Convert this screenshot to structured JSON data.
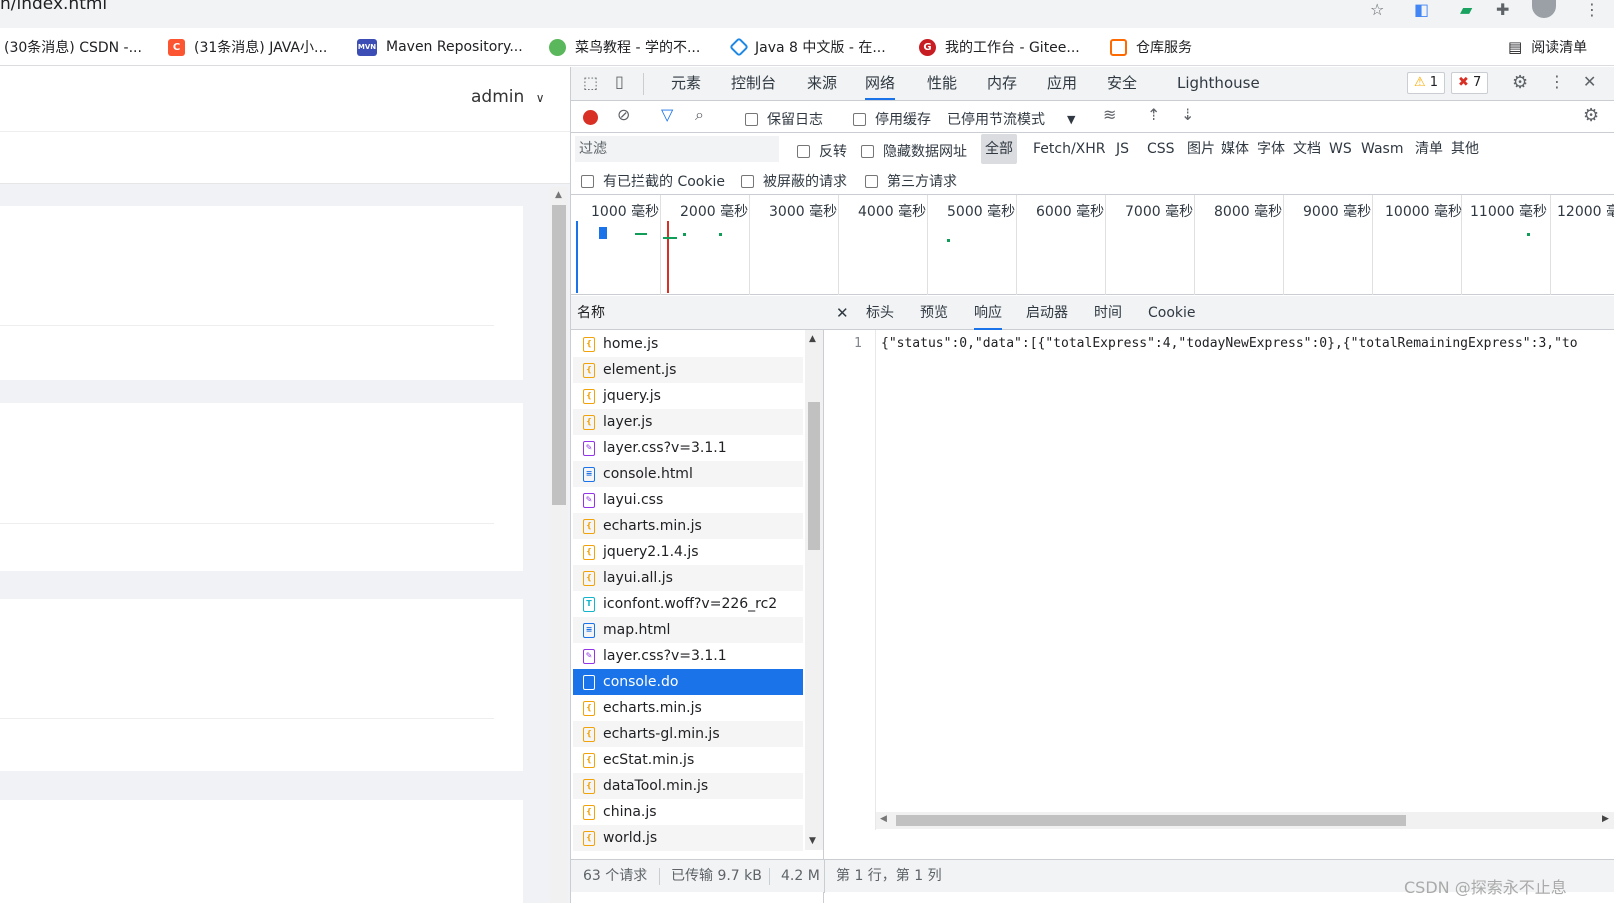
{
  "address": {
    "url": "n/index.html"
  },
  "bookmarks": [
    {
      "label": "(30条消息) CSDN -...",
      "color": "#ffffff",
      "glyph": ""
    },
    {
      "label": "(31条消息) JAVA小...",
      "color": "#fc5531",
      "glyph": "C"
    },
    {
      "label": "Maven Repository...",
      "color": "#3c4db5",
      "glyph": "MVN"
    },
    {
      "label": "菜鸟教程 - 学的不...",
      "color": "#5bb75b",
      "glyph": ""
    },
    {
      "label": "Java 8 中文版 - 在...",
      "color": "#1e88e5",
      "glyph": ""
    },
    {
      "label": "我的工作台 - Gitee...",
      "color": "#c71d23",
      "glyph": "G"
    },
    {
      "label": "仓库服务",
      "color": "#ff6a00",
      "glyph": ""
    }
  ],
  "reading_list": "阅读清单",
  "page": {
    "user": "admin"
  },
  "devtools": {
    "tabs": [
      "元素",
      "控制台",
      "来源",
      "网络",
      "性能",
      "内存",
      "应用",
      "安全",
      "Lighthouse"
    ],
    "active_tab": "网络",
    "warnings": "1",
    "errors": "7",
    "toolbar": {
      "preserve_log": "保留日志",
      "disable_cache": "停用缓存",
      "throttling": "已停用节流模式"
    },
    "filter": {
      "placeholder": "过滤",
      "invert": "反转",
      "hide_data_urls": "隐藏数据网址",
      "types": [
        "全部",
        "Fetch/XHR",
        "JS",
        "CSS",
        "图片",
        "媒体",
        "字体",
        "文档",
        "WS",
        "Wasm",
        "清单",
        "其他"
      ],
      "blocked_cookies": "有已拦截的 Cookie",
      "blocked_requests": "被屏蔽的请求",
      "third_party": "第三方请求"
    },
    "timeline_labels": [
      "1000 毫秒",
      "2000 毫秒",
      "3000 毫秒",
      "4000 毫秒",
      "5000 毫秒",
      "6000 毫秒",
      "7000 毫秒",
      "8000 毫秒",
      "9000 毫秒",
      "10000 毫秒",
      "11000 毫秒",
      "12000 毫"
    ],
    "name_header": "名称",
    "requests": [
      {
        "name": "home.js",
        "type": "js"
      },
      {
        "name": "element.js",
        "type": "js"
      },
      {
        "name": "jquery.js",
        "type": "js"
      },
      {
        "name": "layer.js",
        "type": "js"
      },
      {
        "name": "layer.css?v=3.1.1",
        "type": "css"
      },
      {
        "name": "console.html",
        "type": "doc"
      },
      {
        "name": "layui.css",
        "type": "css"
      },
      {
        "name": "echarts.min.js",
        "type": "js"
      },
      {
        "name": "jquery2.1.4.js",
        "type": "js"
      },
      {
        "name": "layui.all.js",
        "type": "js"
      },
      {
        "name": "iconfont.woff?v=226_rc2",
        "type": "font"
      },
      {
        "name": "map.html",
        "type": "doc"
      },
      {
        "name": "layer.css?v=3.1.1",
        "type": "css"
      },
      {
        "name": "console.do",
        "type": "fetch",
        "selected": true
      },
      {
        "name": "echarts.min.js",
        "type": "js"
      },
      {
        "name": "echarts-gl.min.js",
        "type": "js"
      },
      {
        "name": "ecStat.min.js",
        "type": "js"
      },
      {
        "name": "dataTool.min.js",
        "type": "js"
      },
      {
        "name": "china.js",
        "type": "js"
      },
      {
        "name": "world.js",
        "type": "js"
      }
    ],
    "detail_tabs": [
      "标头",
      "预览",
      "响应",
      "启动器",
      "时间",
      "Cookie"
    ],
    "active_detail_tab": "响应",
    "response": {
      "line_number": "1",
      "body": "{\"status\":0,\"data\":[{\"totalExpress\":4,\"todayNewExpress\":0},{\"totalRemainingExpress\":3,\"to"
    },
    "status": {
      "requests": "63 个请求",
      "transferred": "已传输 9.7 kB",
      "resources": "4.2 M",
      "cursor": "第 1 行，第 1 列"
    }
  },
  "watermark": "CSDN @探索永不止息"
}
